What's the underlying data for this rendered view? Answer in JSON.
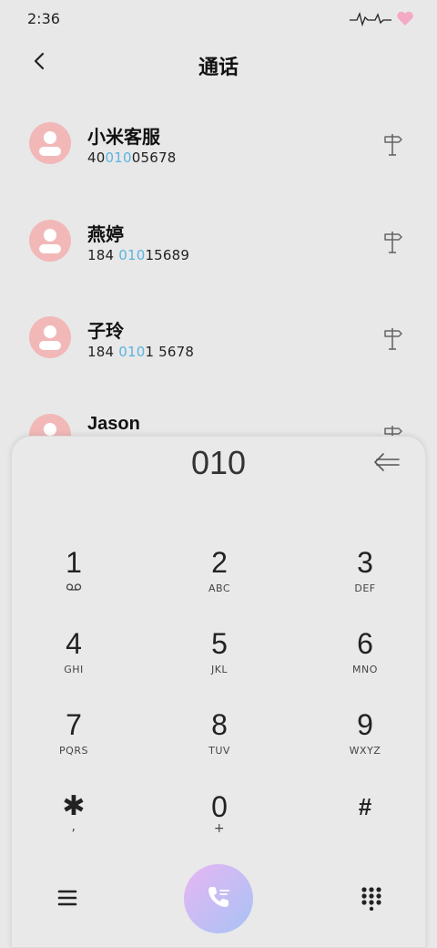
{
  "status_bar": {
    "time": "2:36"
  },
  "header": {
    "title": "通话"
  },
  "contacts": [
    {
      "name": "小米客服",
      "number_parts": [
        "40",
        "010",
        "05678"
      ]
    },
    {
      "name": "燕婷",
      "number_parts": [
        "184 ",
        "010",
        "15689"
      ]
    },
    {
      "name": "子玲",
      "number_parts": [
        "184 ",
        "010",
        "1 5678"
      ]
    },
    {
      "name": "Jason"
    }
  ],
  "dialpad": {
    "typed_number": "010",
    "keys": [
      {
        "digit": "1",
        "letters": ""
      },
      {
        "digit": "2",
        "letters": "ABC"
      },
      {
        "digit": "3",
        "letters": "DEF"
      },
      {
        "digit": "4",
        "letters": "GHI"
      },
      {
        "digit": "5",
        "letters": "JKL"
      },
      {
        "digit": "6",
        "letters": "MNO"
      },
      {
        "digit": "7",
        "letters": "PQRS"
      },
      {
        "digit": "8",
        "letters": "TUV"
      },
      {
        "digit": "9",
        "letters": "WXYZ"
      },
      {
        "digit": "✱",
        "letters": ","
      },
      {
        "digit": "0",
        "letters": "+"
      },
      {
        "digit": "#",
        "letters": ""
      }
    ]
  },
  "icons": {
    "back": "chevron-left-icon",
    "signpost": "signpost-icon",
    "voicemail": "voicemail-icon",
    "backspace": "backspace-arrow-icon",
    "menu": "menu-icon",
    "call": "phone-icon",
    "keypad": "keypad-grid-icon"
  },
  "colors": {
    "background": "#e8e8e8",
    "avatar": "#f2b8b8",
    "highlight": "#5ab4e0",
    "call_gradient_start": "#e7b6f3",
    "call_gradient_end": "#a7c3f5"
  }
}
